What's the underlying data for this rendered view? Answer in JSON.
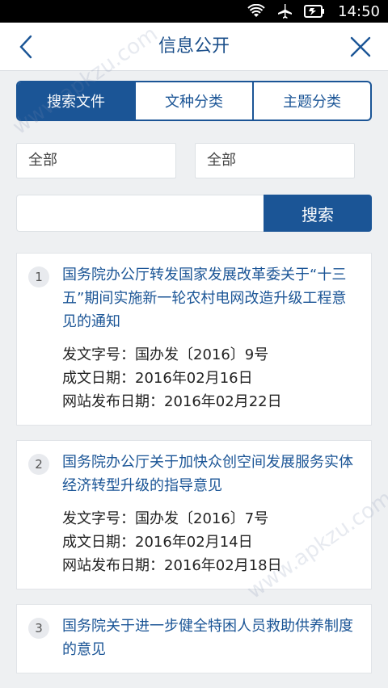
{
  "status_bar": {
    "time": "14:50",
    "icons": [
      "wifi-icon",
      "airplane-icon",
      "battery-icon"
    ]
  },
  "header": {
    "title": "信息公开",
    "back_icon": "chevron-left-icon",
    "close_icon": "close-icon"
  },
  "tabs": [
    {
      "label": "搜索文件",
      "active": true
    },
    {
      "label": "文种分类",
      "active": false
    },
    {
      "label": "主题分类",
      "active": false
    }
  ],
  "filters": {
    "left_value": "全部",
    "right_value": "全部"
  },
  "search": {
    "input_value": "",
    "button_label": "搜索"
  },
  "results": [
    {
      "num": "1",
      "title": "国务院办公厅转发国家发展改革委关于“十三五”期间实施新一轮农村电网改造升级工程意见的通知",
      "doc_number": "发文字号：国办发〔2016〕9号",
      "created": "成文日期：2016年02月16日",
      "published": "网站发布日期：2016年02月22日"
    },
    {
      "num": "2",
      "title": "国务院办公厅关于加快众创空间发展服务实体经济转型升级的指导意见",
      "doc_number": "发文字号：国办发〔2016〕7号",
      "created": "成文日期：2016年02月14日",
      "published": "网站发布日期：2016年02月18日"
    },
    {
      "num": "3",
      "title": "国务院关于进一步健全特困人员救助供养制度的意见"
    }
  ],
  "watermark": "www.apkzu.com",
  "colors": {
    "brand": "#1b5596",
    "background": "#eef0f2"
  }
}
